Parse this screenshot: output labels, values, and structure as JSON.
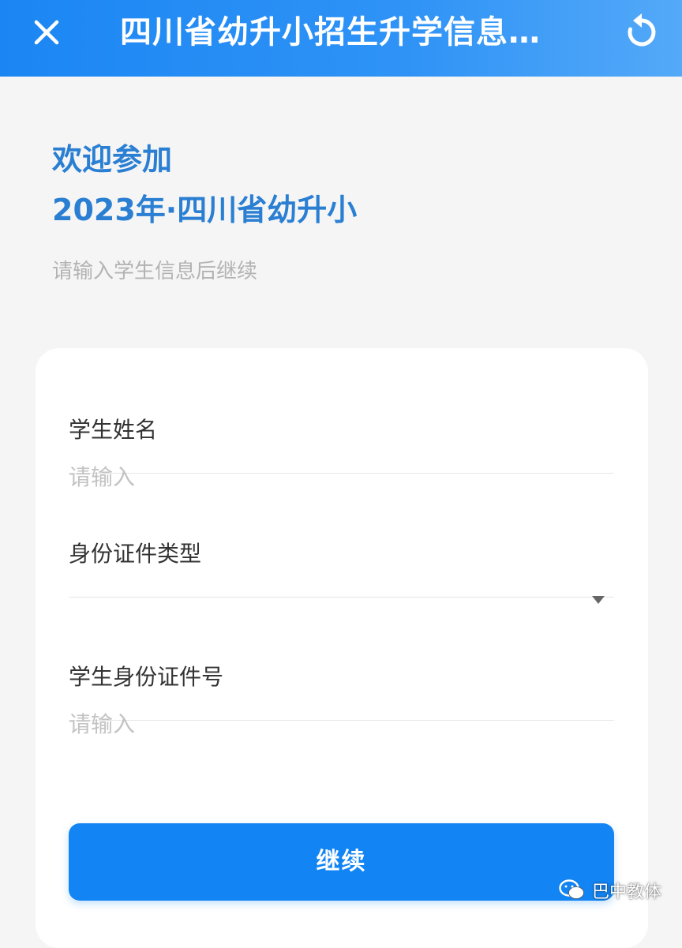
{
  "header": {
    "title": "四川省幼升小招生升学信息管...",
    "close_icon": "close-icon",
    "refresh_icon": "refresh-icon",
    "background": "#1b86f3"
  },
  "welcome": {
    "line1": "欢迎参加",
    "line2": "2023年·四川省幼升小",
    "color": "#2a7fd3"
  },
  "subtitle": "请输入学生信息后继续",
  "form": {
    "fields": [
      {
        "label": "学生姓名",
        "type": "text",
        "value": "",
        "placeholder": "请输入"
      },
      {
        "label": "身份证件类型",
        "type": "select",
        "value": "",
        "icon": "caret-down-icon"
      },
      {
        "label": "学生身份证件号",
        "type": "text",
        "value": "",
        "placeholder": "请输入"
      }
    ]
  },
  "continue_button": {
    "label": "继续",
    "color": "#1284f3"
  },
  "watermark": {
    "icon": "wechat-icon",
    "text": "巴中教体"
  }
}
